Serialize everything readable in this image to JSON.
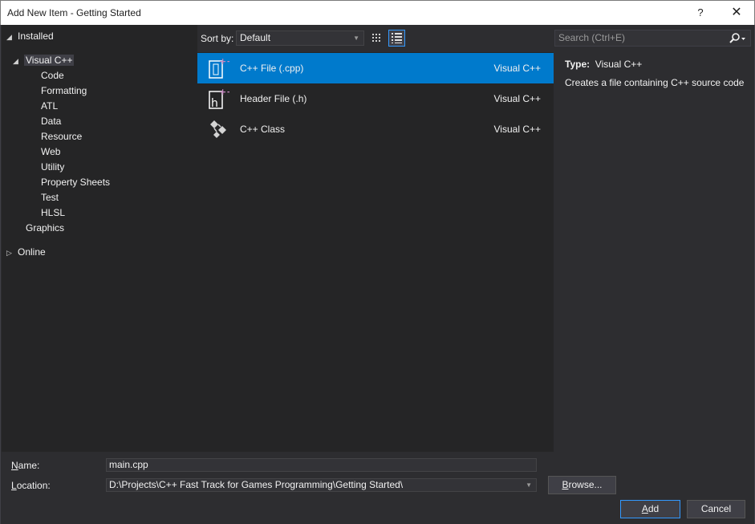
{
  "window": {
    "title": "Add New Item - Getting Started",
    "help_glyph": "?",
    "close_glyph": "✕"
  },
  "tree": {
    "installed": "Installed",
    "visual_cpp": "Visual C++",
    "children": [
      "Code",
      "Formatting",
      "ATL",
      "Data",
      "Resource",
      "Web",
      "Utility",
      "Property Sheets",
      "Test",
      "HLSL"
    ],
    "graphics": "Graphics",
    "online": "Online"
  },
  "toolbar": {
    "sort_label": "Sort by:",
    "sort_value": "Default",
    "view_medium_icons": "grid-view-icon",
    "view_list": "list-view-icon"
  },
  "search": {
    "placeholder": "Search (Ctrl+E)"
  },
  "templates": [
    {
      "name": "C++ File (.cpp)",
      "language": "Visual C++",
      "icon": "cpp-file-icon",
      "selected": true
    },
    {
      "name": "Header File (.h)",
      "language": "Visual C++",
      "icon": "header-file-icon",
      "selected": false
    },
    {
      "name": "C++ Class",
      "language": "Visual C++",
      "icon": "cpp-class-icon",
      "selected": false
    }
  ],
  "details": {
    "type_label": "Type:",
    "type_value": "Visual C++",
    "description": "Creates a file containing C++ source code"
  },
  "form": {
    "name_label_u": "N",
    "name_label_rest": "ame:",
    "name_value": "main.cpp",
    "location_label_u": "L",
    "location_label_rest": "ocation:",
    "location_value": "D:\\Projects\\C++ Fast Track for Games Programming\\Getting Started\\",
    "browse_u": "B",
    "browse_rest": "rowse...",
    "add_u": "A",
    "add_rest": "dd",
    "cancel": "Cancel"
  },
  "colors": {
    "accent": "#007acc",
    "background": "#2d2d30",
    "panel": "#252526",
    "text": "#f1f1f1"
  }
}
